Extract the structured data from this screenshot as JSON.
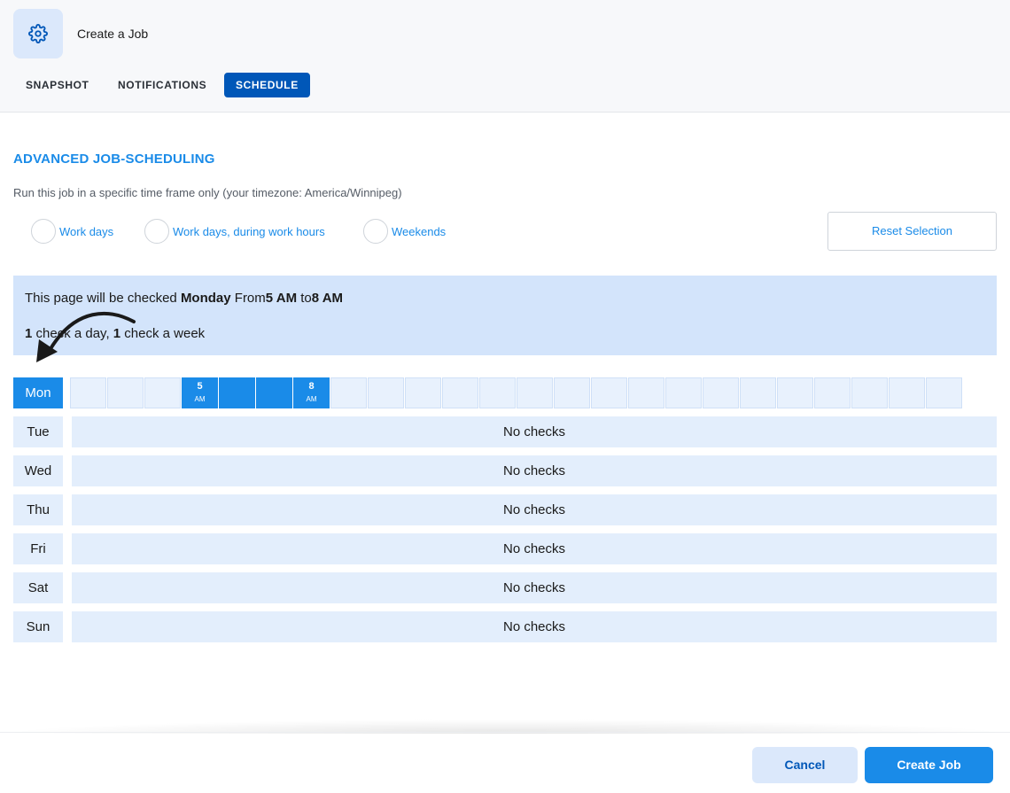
{
  "header": {
    "title": "Create a Job",
    "icon": "gear-icon",
    "tabs": [
      {
        "label": "SNAPSHOT",
        "active": false
      },
      {
        "label": "NOTIFICATIONS",
        "active": false
      },
      {
        "label": "SCHEDULE",
        "active": true
      }
    ]
  },
  "scheduling": {
    "title": "ADVANCED JOB-SCHEDULING",
    "subtitle": "Run this job in a specific time frame only (your timezone: America/Winnipeg)",
    "presets": [
      {
        "label": "Work days",
        "selected": false
      },
      {
        "label": "Work days, during work hours",
        "selected": false
      },
      {
        "label": "Weekends",
        "selected": false
      }
    ],
    "reset_label": "Reset Selection"
  },
  "info": {
    "prefix": "This page will be checked ",
    "day": "Monday",
    "from_word": " From",
    "from_time": "5 AM",
    "to_word": " to",
    "to_time": "8 AM",
    "per_day_count": "1",
    "per_day_text": " check a day, ",
    "per_week_count": "1",
    "per_week_text": " check a week"
  },
  "schedule": {
    "days": [
      {
        "label": "Mon",
        "active": true,
        "status": ""
      },
      {
        "label": "Tue",
        "active": false,
        "status": "No checks"
      },
      {
        "label": "Wed",
        "active": false,
        "status": "No checks"
      },
      {
        "label": "Thu",
        "active": false,
        "status": "No checks"
      },
      {
        "label": "Fri",
        "active": false,
        "status": "No checks"
      },
      {
        "label": "Sat",
        "active": false,
        "status": "No checks"
      },
      {
        "label": "Sun",
        "active": false,
        "status": "No checks"
      }
    ],
    "hour_slots": 24,
    "selected_hours": [
      5,
      6,
      7,
      8
    ],
    "start_label": {
      "num": "5",
      "ampm": "AM"
    },
    "end_label": {
      "num": "8",
      "ampm": "AM"
    }
  },
  "footer": {
    "cancel_label": "Cancel",
    "create_label": "Create Job"
  },
  "colors": {
    "accent": "#1a8be8",
    "tab_active": "#0057b8",
    "light_fill": "#e3eefc"
  }
}
